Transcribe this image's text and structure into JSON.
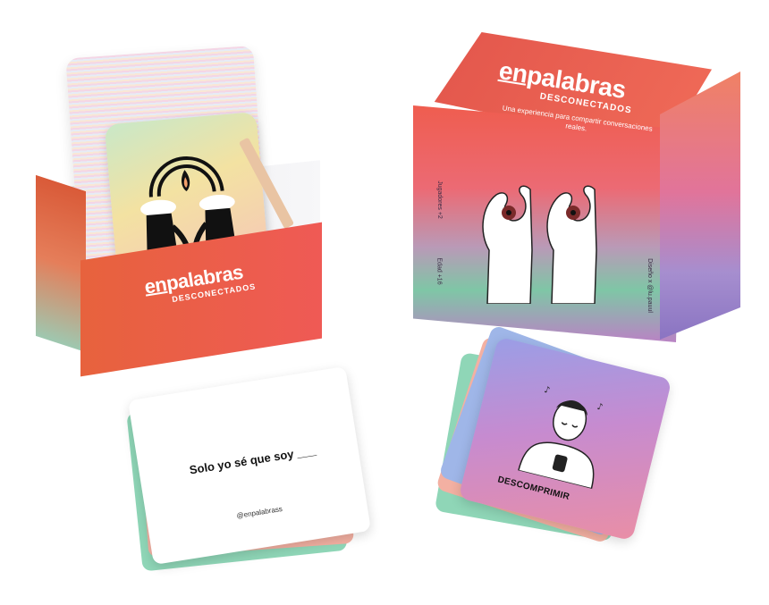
{
  "left_box": {
    "logo_en": "en",
    "logo_rest": "palabras",
    "logo_sub": "DESCONECTADOS"
  },
  "right_box": {
    "logo_en": "en",
    "logo_rest": "palabras",
    "logo_sub": "DESCONECTADOS",
    "tagline": "Una experiencia para compartir conversaciones reales.",
    "players": "Jugadores +2",
    "age": "Edad +16",
    "design_credit": "Diseño x @lu.pauul"
  },
  "white_card": {
    "question": "Solo yo sé que soy ___",
    "handle": "@enpalabrass"
  },
  "purple_card": {
    "title": "DESCOMPRIMIR"
  },
  "colors": {
    "box_red": "#e5553d",
    "box_pink": "#ef5a55",
    "card_purple": "#c68bd0",
    "card_mint": "#7fc6a6"
  }
}
